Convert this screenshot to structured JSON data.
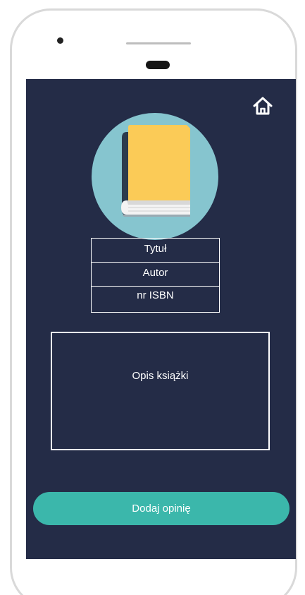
{
  "book": {
    "fields": [
      {
        "label": "Tytuł"
      },
      {
        "label": "Autor"
      },
      {
        "label": "nr ISBN"
      }
    ],
    "description": "Opis książki"
  },
  "actions": {
    "add_review": "Dodaj opinię"
  },
  "icons": {
    "home": "home-icon",
    "cover": "book-icon"
  },
  "colors": {
    "screen_bg": "#242c47",
    "cover_circle": "#86c5cf",
    "book_cover": "#fbcb57",
    "book_spine": "#2b3b4d",
    "button": "#3bb7ab"
  }
}
